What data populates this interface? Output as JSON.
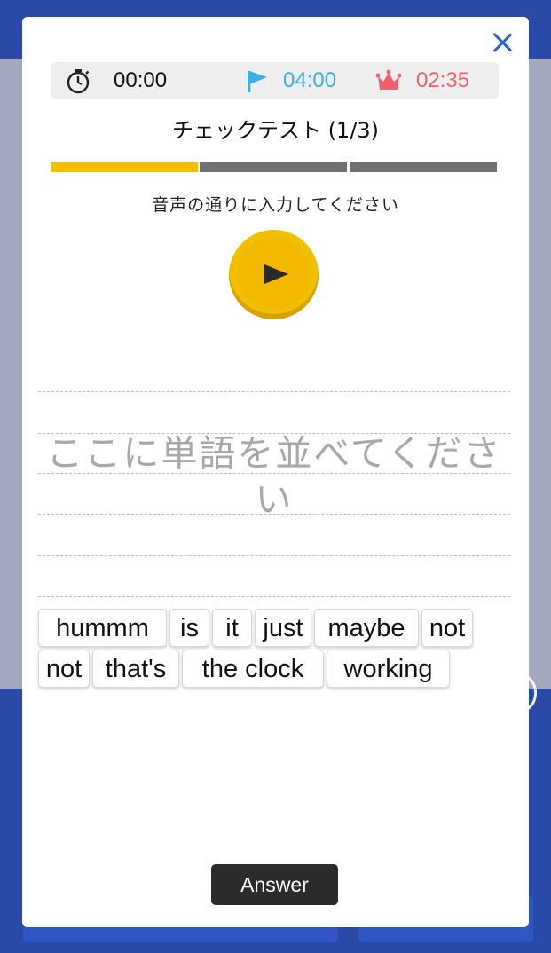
{
  "timer": {
    "elapsed": "00:00",
    "target": "04:00",
    "best": "02:35",
    "target_color": "#3aaee0",
    "best_color": "#f0606a"
  },
  "test": {
    "title": "チェックテスト (1/3)",
    "progress": {
      "current": 1,
      "total": 3,
      "active_color": "#f7bd00",
      "inactive_color": "#707070"
    },
    "instruction": "音声の通りに入力してください"
  },
  "answer_area": {
    "placeholder": "ここに単語を並べてください"
  },
  "word_chips": [
    {
      "label": "hummm"
    },
    {
      "label": "is"
    },
    {
      "label": "it"
    },
    {
      "label": "just"
    },
    {
      "label": "maybe"
    },
    {
      "label": "not"
    },
    {
      "label": "not"
    },
    {
      "label": "that's"
    },
    {
      "label": "the clock"
    },
    {
      "label": "working"
    }
  ],
  "answer_button": {
    "label": "Answer"
  },
  "icons": [
    "close-icon",
    "stopwatch-icon",
    "flag-icon",
    "crown-icon",
    "play-icon"
  ],
  "colors": {
    "header_blue": "#2a4aa8",
    "play_yellow": "#f0c000"
  }
}
